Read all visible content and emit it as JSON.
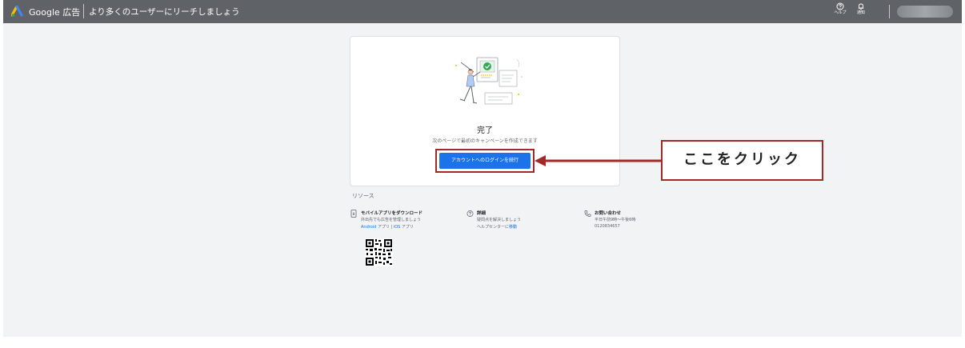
{
  "header": {
    "brand": "Google 広告",
    "headline": "より多くのユーザーにリーチしましょう",
    "help_label": "ヘルプ",
    "notifications_label": "通知",
    "bar_color": "#5f6368"
  },
  "card": {
    "title": "完了",
    "subtitle": "次のページで最初のキャンペーンを作成できます",
    "button_label": "アカウントへのログインを続行",
    "button_color": "#1a73e8"
  },
  "annotation": {
    "callout_text": "ここをクリック",
    "highlight_color": "#a3282a"
  },
  "resources": {
    "title": "リソース",
    "mobile": {
      "title": "モバイルアプリをダウンロード",
      "desc": "外出先でも広告を管理しましょう",
      "android": "Android",
      "android_suffix": "アプリ",
      "separator": "|",
      "ios": "iOS",
      "ios_suffix": "アプリ"
    },
    "details": {
      "title": "詳細",
      "desc": "疑問点を解決しましょう",
      "link_prefix": "ヘルプセンターに",
      "link": "移動"
    },
    "contact": {
      "title": "お問い合わせ",
      "hours": "平日午前9時〜午後6時",
      "phone": "0120834657"
    }
  }
}
